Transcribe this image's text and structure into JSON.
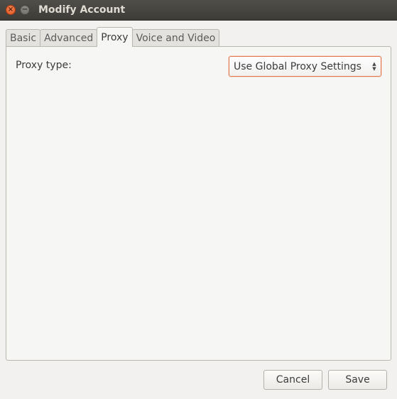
{
  "window": {
    "title": "Modify Account",
    "close_icon": "×",
    "minimize_icon": "−"
  },
  "tabs": [
    {
      "label": "Basic",
      "active": false
    },
    {
      "label": "Advanced",
      "active": false
    },
    {
      "label": "Proxy",
      "active": true
    },
    {
      "label": "Voice and Video",
      "active": false
    }
  ],
  "proxy": {
    "label": "Proxy type:",
    "selected": "Use Global Proxy Settings",
    "arrow_up": "▲",
    "arrow_down": "▼"
  },
  "buttons": {
    "cancel": "Cancel",
    "save": "Save"
  },
  "colors": {
    "accent": "#e0774c",
    "titlebar": "#3d3c38",
    "background": "#f2f1f0"
  }
}
